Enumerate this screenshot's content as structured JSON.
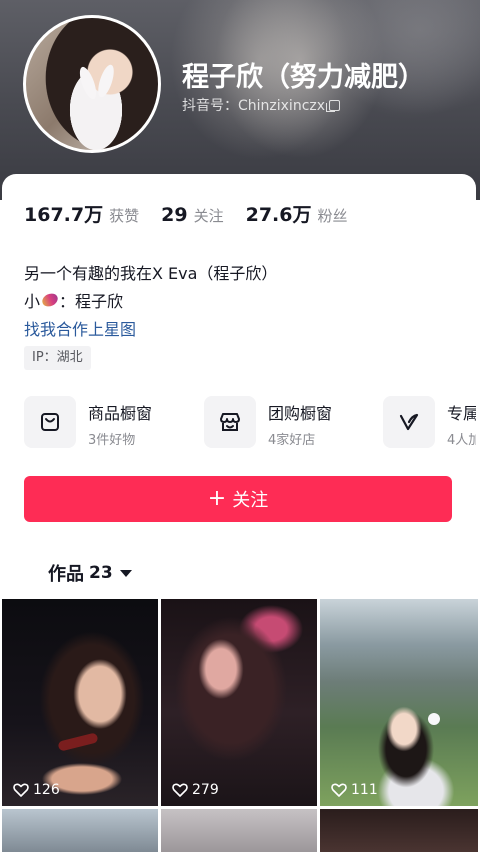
{
  "profile": {
    "name": "程子欣（努力减肥）",
    "douyin_id_label": "抖音号：",
    "douyin_id": "Chinzixinczx"
  },
  "stats": [
    {
      "value": "167.7万",
      "label": "获赞"
    },
    {
      "value": "29",
      "label": "关注"
    },
    {
      "value": "27.6万",
      "label": "粉丝"
    }
  ],
  "bio": {
    "line1": "另一个有趣的我在X Eva（程子欣）",
    "line2_prefix": "小",
    "line2_suffix": "：程子欣",
    "link": "找我合作上星图",
    "ip": "IP：湖北"
  },
  "services": [
    {
      "title": "商品橱窗",
      "subtitle": "3件好物",
      "icon": "shop-bag-icon"
    },
    {
      "title": "团购橱窗",
      "subtitle": "4家好店",
      "icon": "storefront-icon"
    },
    {
      "title": "专属",
      "subtitle": "4人加",
      "icon": "v-badge-icon"
    }
  ],
  "follow_button": {
    "label": "关注"
  },
  "works_tab": {
    "label": "作品",
    "count": "23"
  },
  "videos": [
    {
      "likes": "126"
    },
    {
      "likes": "279"
    },
    {
      "likes": "111"
    }
  ],
  "colors": {
    "accent": "#fe2c55",
    "link": "#2b5a9c",
    "muted_text": "#8a8b91",
    "primary_text": "#161823"
  }
}
